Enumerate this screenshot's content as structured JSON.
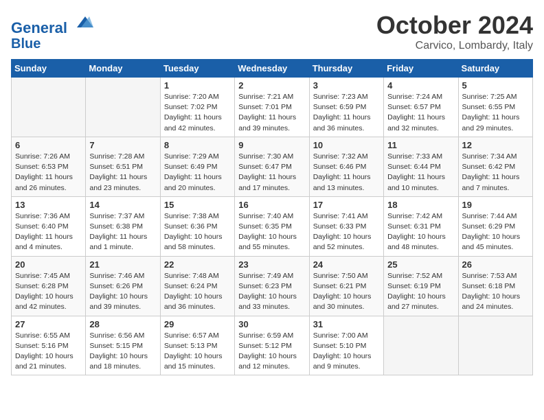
{
  "header": {
    "logo_line1": "General",
    "logo_line2": "Blue",
    "month": "October 2024",
    "location": "Carvico, Lombardy, Italy"
  },
  "days_of_week": [
    "Sunday",
    "Monday",
    "Tuesday",
    "Wednesday",
    "Thursday",
    "Friday",
    "Saturday"
  ],
  "weeks": [
    [
      {
        "num": "",
        "sunrise": "",
        "sunset": "",
        "daylight": "",
        "empty": true
      },
      {
        "num": "",
        "sunrise": "",
        "sunset": "",
        "daylight": "",
        "empty": true
      },
      {
        "num": "1",
        "sunrise": "Sunrise: 7:20 AM",
        "sunset": "Sunset: 7:02 PM",
        "daylight": "Daylight: 11 hours and 42 minutes."
      },
      {
        "num": "2",
        "sunrise": "Sunrise: 7:21 AM",
        "sunset": "Sunset: 7:01 PM",
        "daylight": "Daylight: 11 hours and 39 minutes."
      },
      {
        "num": "3",
        "sunrise": "Sunrise: 7:23 AM",
        "sunset": "Sunset: 6:59 PM",
        "daylight": "Daylight: 11 hours and 36 minutes."
      },
      {
        "num": "4",
        "sunrise": "Sunrise: 7:24 AM",
        "sunset": "Sunset: 6:57 PM",
        "daylight": "Daylight: 11 hours and 32 minutes."
      },
      {
        "num": "5",
        "sunrise": "Sunrise: 7:25 AM",
        "sunset": "Sunset: 6:55 PM",
        "daylight": "Daylight: 11 hours and 29 minutes."
      }
    ],
    [
      {
        "num": "6",
        "sunrise": "Sunrise: 7:26 AM",
        "sunset": "Sunset: 6:53 PM",
        "daylight": "Daylight: 11 hours and 26 minutes."
      },
      {
        "num": "7",
        "sunrise": "Sunrise: 7:28 AM",
        "sunset": "Sunset: 6:51 PM",
        "daylight": "Daylight: 11 hours and 23 minutes."
      },
      {
        "num": "8",
        "sunrise": "Sunrise: 7:29 AM",
        "sunset": "Sunset: 6:49 PM",
        "daylight": "Daylight: 11 hours and 20 minutes."
      },
      {
        "num": "9",
        "sunrise": "Sunrise: 7:30 AM",
        "sunset": "Sunset: 6:47 PM",
        "daylight": "Daylight: 11 hours and 17 minutes."
      },
      {
        "num": "10",
        "sunrise": "Sunrise: 7:32 AM",
        "sunset": "Sunset: 6:46 PM",
        "daylight": "Daylight: 11 hours and 13 minutes."
      },
      {
        "num": "11",
        "sunrise": "Sunrise: 7:33 AM",
        "sunset": "Sunset: 6:44 PM",
        "daylight": "Daylight: 11 hours and 10 minutes."
      },
      {
        "num": "12",
        "sunrise": "Sunrise: 7:34 AM",
        "sunset": "Sunset: 6:42 PM",
        "daylight": "Daylight: 11 hours and 7 minutes."
      }
    ],
    [
      {
        "num": "13",
        "sunrise": "Sunrise: 7:36 AM",
        "sunset": "Sunset: 6:40 PM",
        "daylight": "Daylight: 11 hours and 4 minutes."
      },
      {
        "num": "14",
        "sunrise": "Sunrise: 7:37 AM",
        "sunset": "Sunset: 6:38 PM",
        "daylight": "Daylight: 11 hours and 1 minute."
      },
      {
        "num": "15",
        "sunrise": "Sunrise: 7:38 AM",
        "sunset": "Sunset: 6:36 PM",
        "daylight": "Daylight: 10 hours and 58 minutes."
      },
      {
        "num": "16",
        "sunrise": "Sunrise: 7:40 AM",
        "sunset": "Sunset: 6:35 PM",
        "daylight": "Daylight: 10 hours and 55 minutes."
      },
      {
        "num": "17",
        "sunrise": "Sunrise: 7:41 AM",
        "sunset": "Sunset: 6:33 PM",
        "daylight": "Daylight: 10 hours and 52 minutes."
      },
      {
        "num": "18",
        "sunrise": "Sunrise: 7:42 AM",
        "sunset": "Sunset: 6:31 PM",
        "daylight": "Daylight: 10 hours and 48 minutes."
      },
      {
        "num": "19",
        "sunrise": "Sunrise: 7:44 AM",
        "sunset": "Sunset: 6:29 PM",
        "daylight": "Daylight: 10 hours and 45 minutes."
      }
    ],
    [
      {
        "num": "20",
        "sunrise": "Sunrise: 7:45 AM",
        "sunset": "Sunset: 6:28 PM",
        "daylight": "Daylight: 10 hours and 42 minutes."
      },
      {
        "num": "21",
        "sunrise": "Sunrise: 7:46 AM",
        "sunset": "Sunset: 6:26 PM",
        "daylight": "Daylight: 10 hours and 39 minutes."
      },
      {
        "num": "22",
        "sunrise": "Sunrise: 7:48 AM",
        "sunset": "Sunset: 6:24 PM",
        "daylight": "Daylight: 10 hours and 36 minutes."
      },
      {
        "num": "23",
        "sunrise": "Sunrise: 7:49 AM",
        "sunset": "Sunset: 6:23 PM",
        "daylight": "Daylight: 10 hours and 33 minutes."
      },
      {
        "num": "24",
        "sunrise": "Sunrise: 7:50 AM",
        "sunset": "Sunset: 6:21 PM",
        "daylight": "Daylight: 10 hours and 30 minutes."
      },
      {
        "num": "25",
        "sunrise": "Sunrise: 7:52 AM",
        "sunset": "Sunset: 6:19 PM",
        "daylight": "Daylight: 10 hours and 27 minutes."
      },
      {
        "num": "26",
        "sunrise": "Sunrise: 7:53 AM",
        "sunset": "Sunset: 6:18 PM",
        "daylight": "Daylight: 10 hours and 24 minutes."
      }
    ],
    [
      {
        "num": "27",
        "sunrise": "Sunrise: 6:55 AM",
        "sunset": "Sunset: 5:16 PM",
        "daylight": "Daylight: 10 hours and 21 minutes."
      },
      {
        "num": "28",
        "sunrise": "Sunrise: 6:56 AM",
        "sunset": "Sunset: 5:15 PM",
        "daylight": "Daylight: 10 hours and 18 minutes."
      },
      {
        "num": "29",
        "sunrise": "Sunrise: 6:57 AM",
        "sunset": "Sunset: 5:13 PM",
        "daylight": "Daylight: 10 hours and 15 minutes."
      },
      {
        "num": "30",
        "sunrise": "Sunrise: 6:59 AM",
        "sunset": "Sunset: 5:12 PM",
        "daylight": "Daylight: 10 hours and 12 minutes."
      },
      {
        "num": "31",
        "sunrise": "Sunrise: 7:00 AM",
        "sunset": "Sunset: 5:10 PM",
        "daylight": "Daylight: 10 hours and 9 minutes."
      },
      {
        "num": "",
        "sunrise": "",
        "sunset": "",
        "daylight": "",
        "empty": true
      },
      {
        "num": "",
        "sunrise": "",
        "sunset": "",
        "daylight": "",
        "empty": true
      }
    ]
  ]
}
